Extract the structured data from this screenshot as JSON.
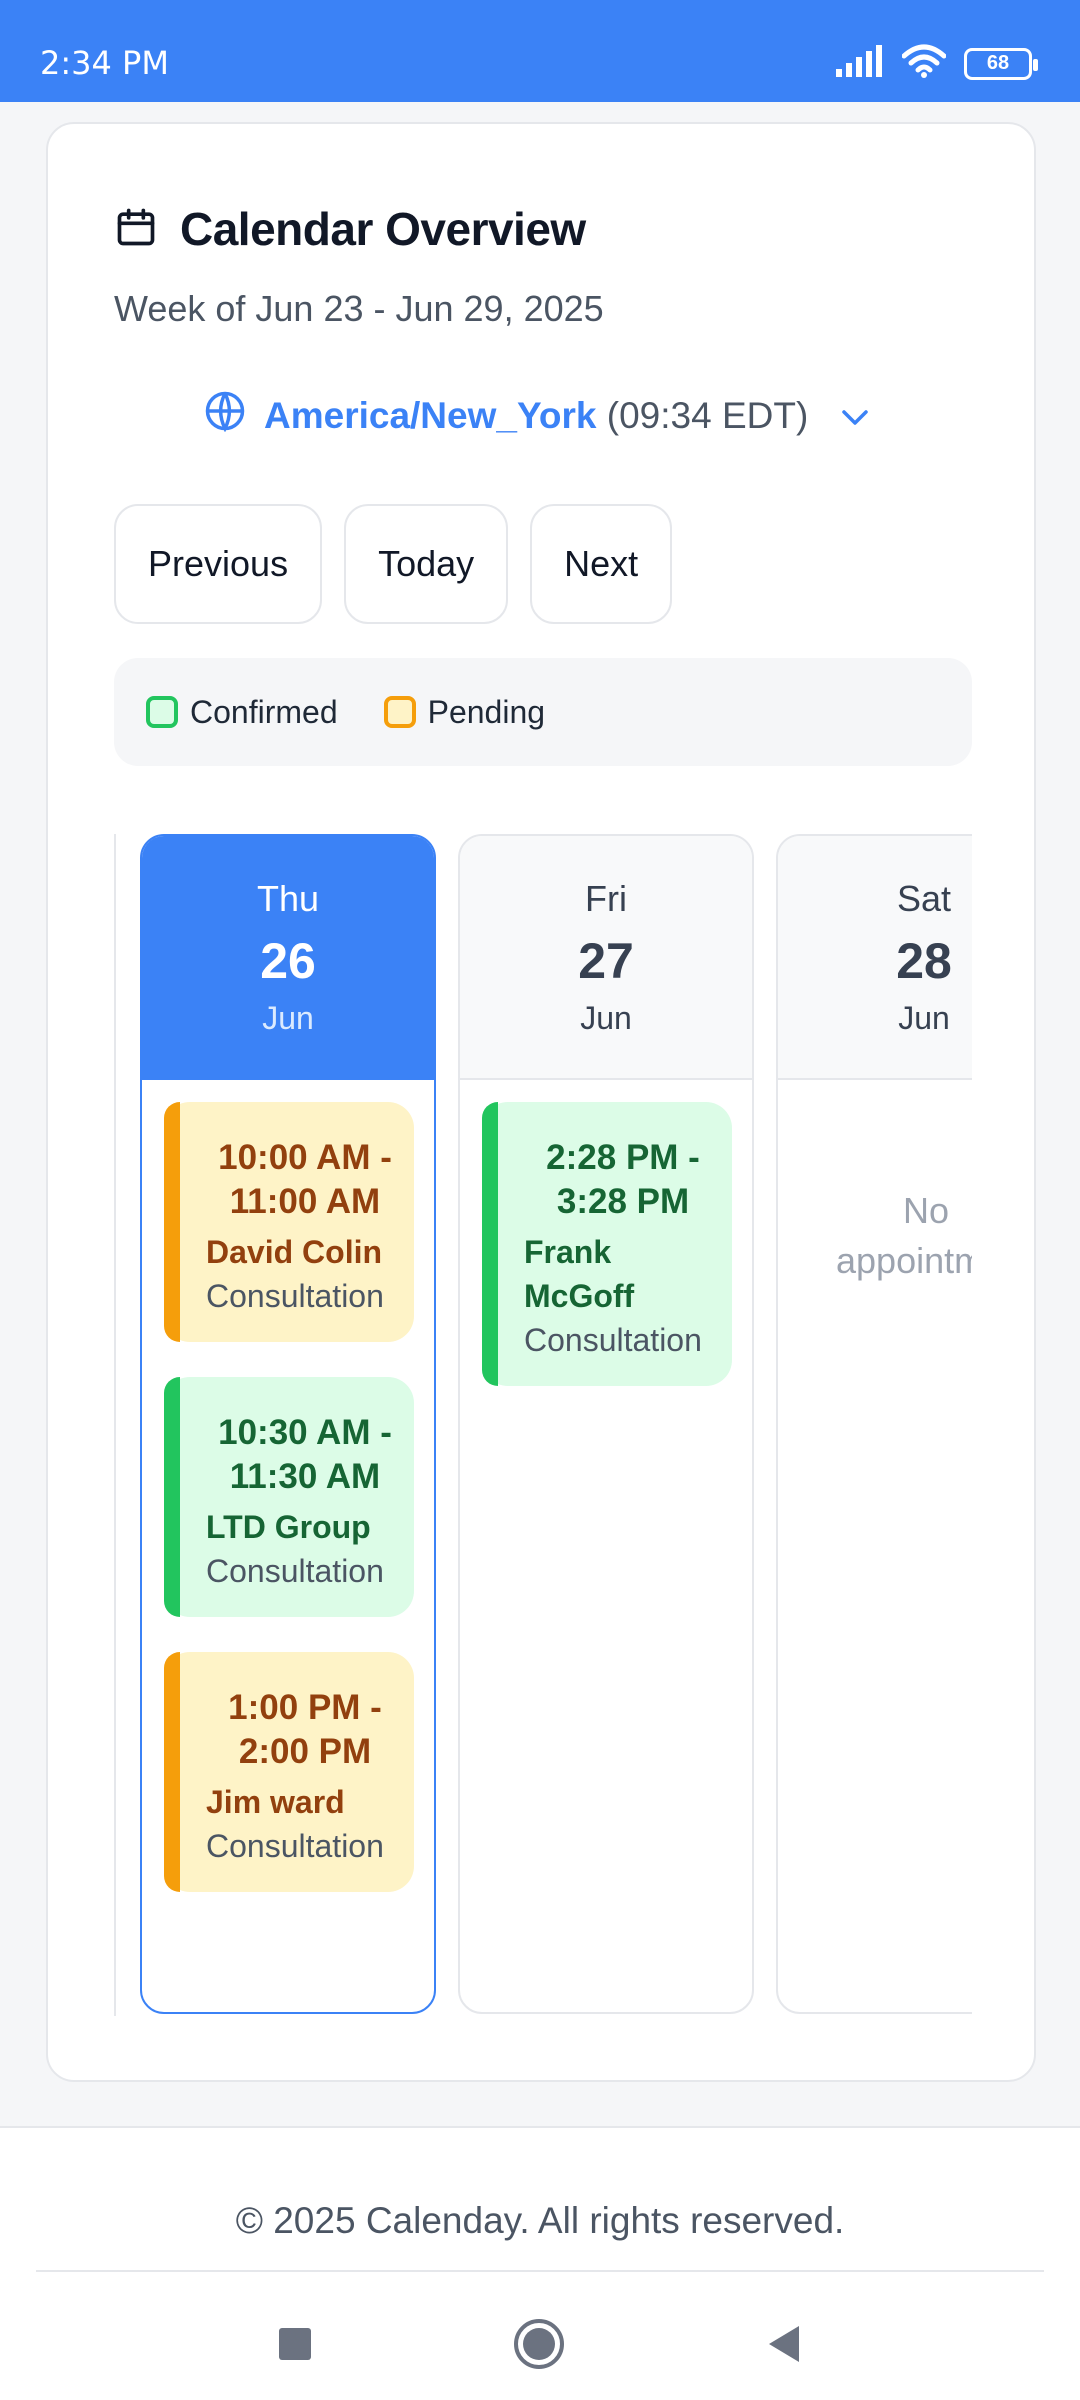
{
  "status_bar": {
    "time": "2:34 PM",
    "battery": "68",
    "icons": [
      "signal-icon",
      "wifi-icon",
      "battery-icon"
    ]
  },
  "header": {
    "title": "Calendar Overview",
    "title_icon": "calendar-icon",
    "week_label": "Week of Jun 23 - Jun 29, 2025"
  },
  "timezone": {
    "name": "America/New_York",
    "time": "(09:34 EDT)",
    "icon": "globe-icon"
  },
  "nav": {
    "previous": "Previous",
    "today": "Today",
    "next": "Next"
  },
  "legend": {
    "confirmed": "Confirmed",
    "pending": "Pending"
  },
  "days": [
    {
      "dow": "Thu",
      "date": "26",
      "month": "Jun",
      "today": true,
      "appointments": [
        {
          "time": "10:00 AM - 11:00 AM",
          "client": "David Colin",
          "type": "Consultation",
          "status": "pending"
        },
        {
          "time": "10:30 AM - 11:30 AM",
          "client": "LTD Group",
          "type": "Consultation",
          "status": "confirmed"
        },
        {
          "time": "1:00 PM - 2:00 PM",
          "client": "Jim ward",
          "type": "Consultation",
          "status": "pending"
        }
      ]
    },
    {
      "dow": "Fri",
      "date": "27",
      "month": "Jun",
      "today": false,
      "appointments": [
        {
          "time": "2:28 PM - 3:28 PM",
          "client": "Frank McGoff",
          "type": "Consultation",
          "status": "confirmed"
        }
      ]
    },
    {
      "dow": "Sat",
      "date": "28",
      "month": "Jun",
      "today": false,
      "empty_text": "No appointments"
    }
  ],
  "footer": {
    "copyright": "© 2025 Calenday. All rights reserved."
  },
  "colors": {
    "accent": "#3b82f6",
    "confirmed": "#22c55e",
    "pending": "#f59e0b"
  }
}
